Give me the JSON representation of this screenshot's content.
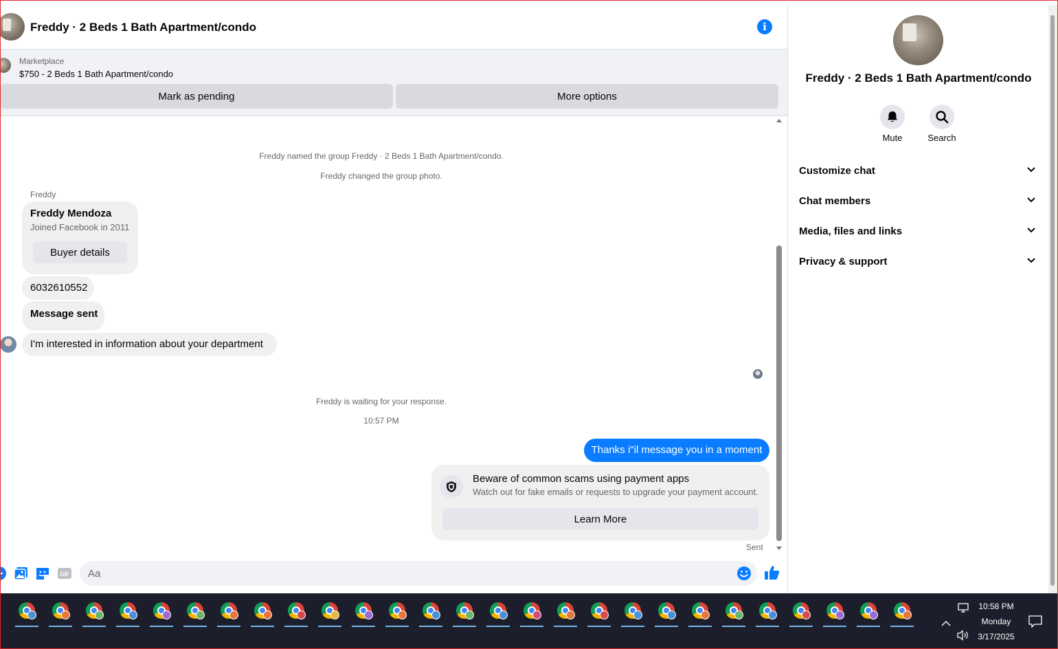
{
  "header": {
    "title": "Freddy · 2 Beds 1 Bath Apartment/condo",
    "info_icon": "info-icon"
  },
  "listing": {
    "source": "Marketplace",
    "title": "$750 - 2 Beds 1 Bath Apartment/condo",
    "pending_label": "Mark as pending",
    "more_label": "More options"
  },
  "messages": {
    "system_1": "Freddy named the group Freddy · 2 Beds 1 Bath Apartment/condo.",
    "system_2": "Freddy changed the group photo.",
    "sender": "Freddy",
    "profile_name": "Freddy Mendoza",
    "profile_sub": "Joined Facebook in 2011",
    "buyer_details": "Buyer details",
    "phone": "6032610552",
    "message_sent": "Message sent",
    "interest": "I'm interested in information about your department",
    "waiting": "Freddy is waiting for your response.",
    "time": "10:57 PM",
    "outgoing": "Thanks i\"il message you in a moment",
    "scam_title": "Beware of common scams using payment apps",
    "scam_body": "Watch out for fake emails or requests to upgrade your payment account.",
    "learn_more": "Learn More",
    "status": "Sent"
  },
  "composer": {
    "placeholder": "Aa",
    "icons": [
      "plus-icon",
      "photo-icon",
      "sticker-icon",
      "gif-icon",
      "emoji-icon",
      "thumbs-up-icon"
    ],
    "gif_text": "GIF"
  },
  "panel": {
    "title": "Freddy · 2 Beds 1 Bath Apartment/condo",
    "mute_label": "Mute",
    "search_label": "Search",
    "rows": [
      {
        "label": "Customize chat"
      },
      {
        "label": "Chat members"
      },
      {
        "label": "Media, files and links"
      },
      {
        "label": "Privacy & support"
      }
    ]
  },
  "taskbar": {
    "time": "10:58 PM",
    "day": "Monday",
    "date": "3/17/2025",
    "app_badge_colors": [
      "#4a90d9",
      "#e8753a",
      "#6bb56b",
      "#4a90d9",
      "#9b6bd6",
      "#6bb56b",
      "#e8753a",
      "#e8753a",
      "#d64a4a",
      "#e8b83a",
      "#9b6bd6",
      "#e8753a",
      "#4a90d9",
      "#6bb56b",
      "#4a90d9",
      "#d64a7a",
      "#e8753a",
      "#d64a4a",
      "#4a90d9",
      "#4a90d9",
      "#e8753a",
      "#6bb56b",
      "#4a90d9",
      "#d64a4a",
      "#9b6bd6",
      "#9b6bd6",
      "#e8753a"
    ]
  },
  "colors": {
    "accent": "#0a7cff",
    "bubble": "#f0f0f0",
    "muted_text": "#65676b"
  }
}
